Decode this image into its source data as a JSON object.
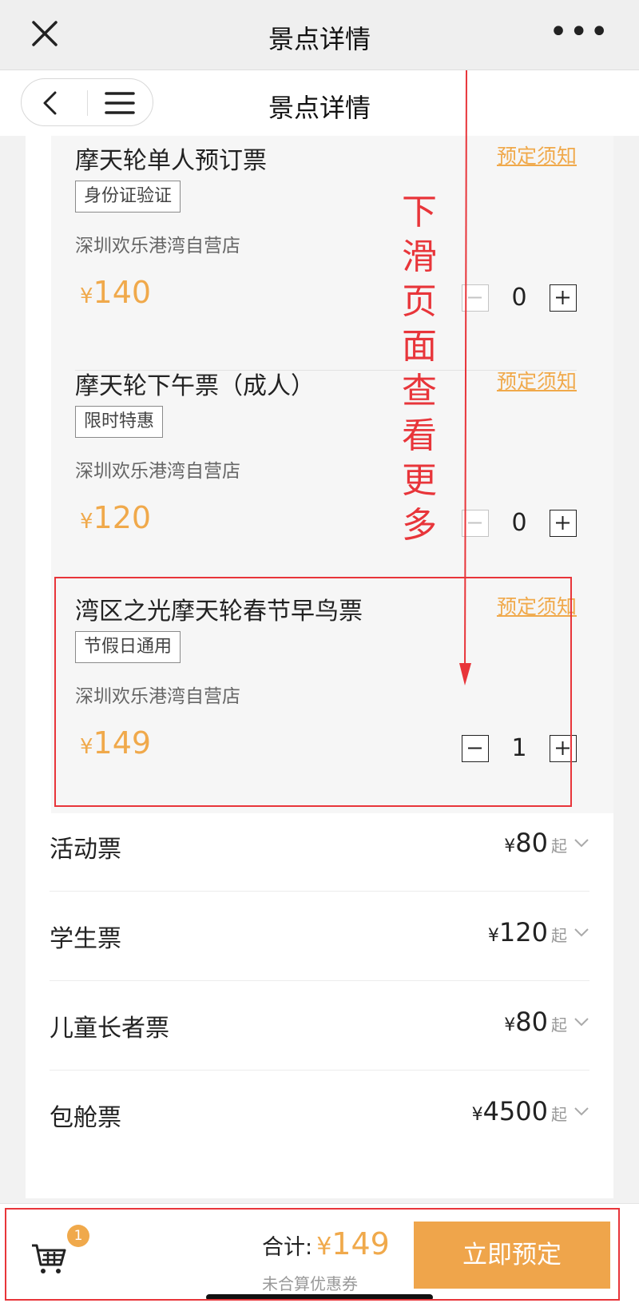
{
  "topbar": {
    "title": "景点详情",
    "more": "•••"
  },
  "navbar": {
    "title": "景点详情"
  },
  "tickets": [
    {
      "name": "摩天轮单人预订票",
      "notice": "预定须知",
      "tag": "身份证验证",
      "store": "深圳欢乐港湾自营店",
      "currency": "¥",
      "price": "140",
      "qty": "0"
    },
    {
      "name": "摩天轮下午票（成人）",
      "notice": "预定须知",
      "tag": "限时特惠",
      "store": "深圳欢乐港湾自营店",
      "currency": "¥",
      "price": "120",
      "qty": "0"
    },
    {
      "name": "湾区之光摩天轮春节早鸟票",
      "notice": "预定须知",
      "tag": "节假日通用",
      "store": "深圳欢乐港湾自营店",
      "currency": "¥",
      "price": "149",
      "qty": "1"
    }
  ],
  "categories": [
    {
      "label": "活动票",
      "currency": "¥",
      "price": "80",
      "suffix": "起"
    },
    {
      "label": "学生票",
      "currency": "¥",
      "price": "120",
      "suffix": "起"
    },
    {
      "label": "儿童长者票",
      "currency": "¥",
      "price": "80",
      "suffix": "起"
    },
    {
      "label": "包舱票",
      "currency": "¥",
      "price": "4500",
      "suffix": "起"
    }
  ],
  "bottom": {
    "cart_count": "1",
    "total_label": "合计:",
    "currency": "¥",
    "total": "149",
    "coupon_note": "未合算优惠券",
    "book_label": "立即预定"
  },
  "annotation": {
    "text": "下滑页面查看更多"
  },
  "colors": {
    "accent": "#f0a94b",
    "annotation": "#e8353a"
  }
}
